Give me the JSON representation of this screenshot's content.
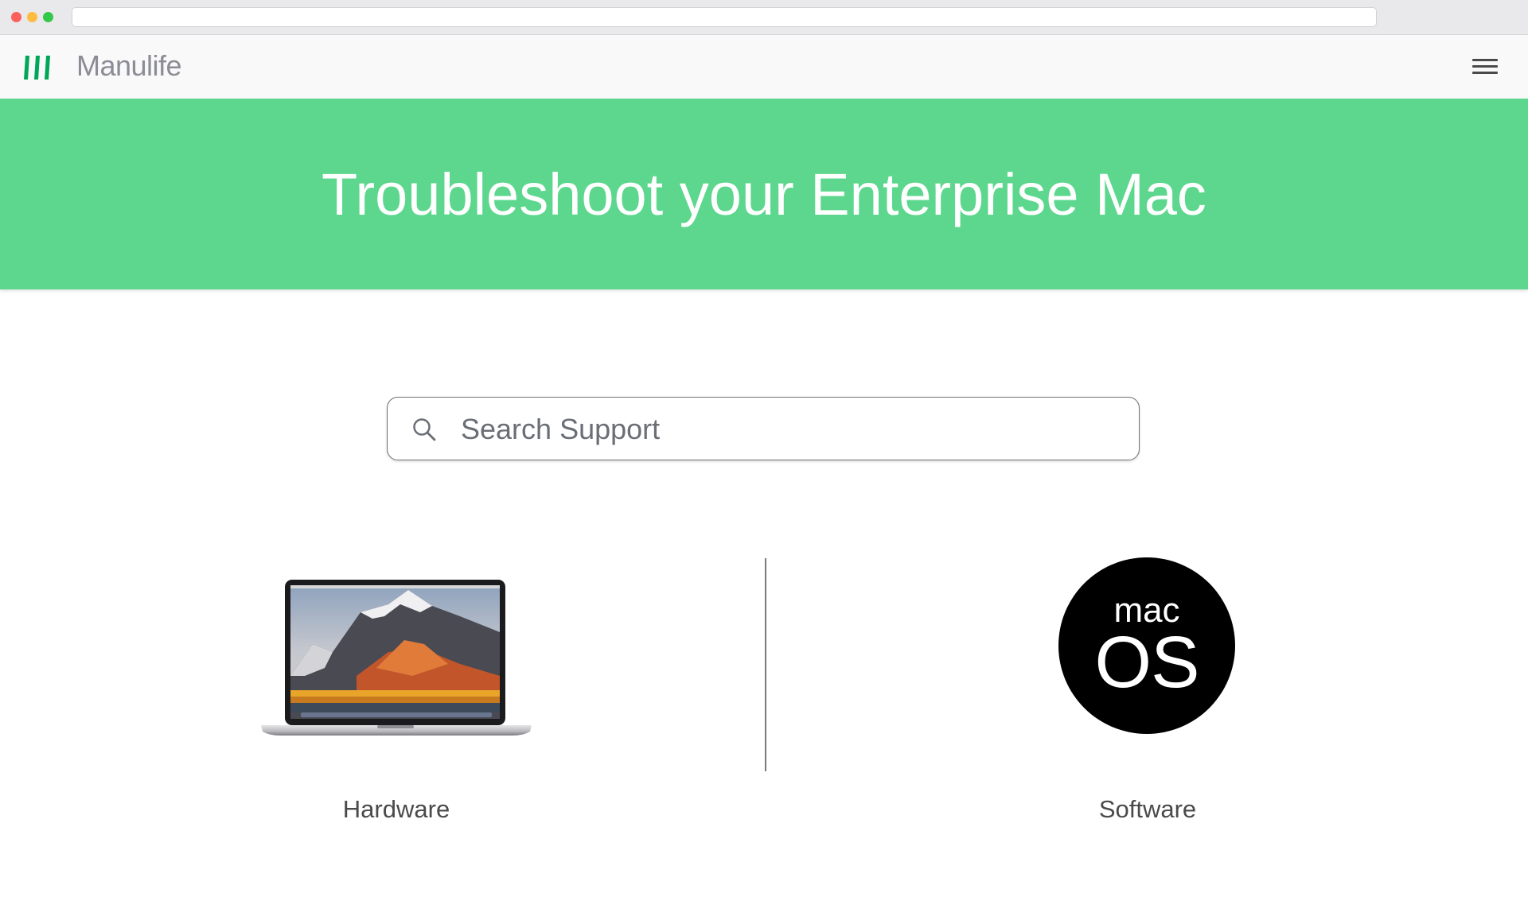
{
  "header": {
    "brand": "Manulife",
    "logo_icon": "manulife-logo-icon",
    "menu_icon": "hamburger-menu-icon"
  },
  "hero": {
    "title": "Troubleshoot your Enterprise Mac"
  },
  "search": {
    "placeholder": "Search Support",
    "icon": "search-icon"
  },
  "categories": [
    {
      "label": "Hardware",
      "icon": "macbook-pro-image"
    },
    {
      "label": "Software",
      "icon": "macos-logo",
      "logo_line1": "mac",
      "logo_line2": "OS"
    }
  ],
  "colors": {
    "brand_green": "#00A758",
    "hero_green": "#5CD78D",
    "brand_gray": "#8C8C96"
  }
}
